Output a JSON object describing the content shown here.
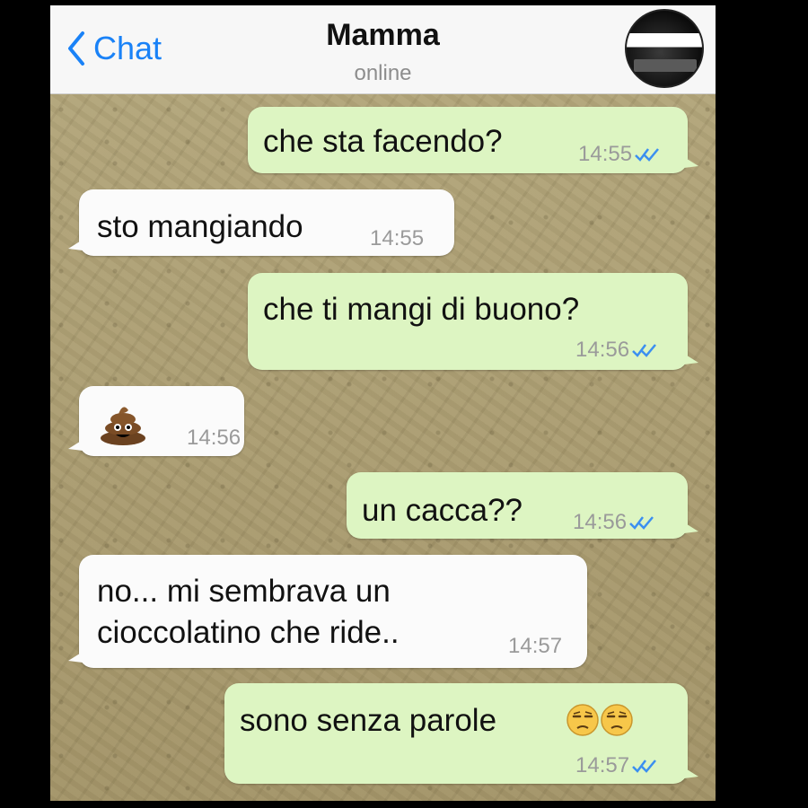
{
  "header": {
    "back_label": "Chat",
    "contact_name": "Mamma",
    "status": "online"
  },
  "messages": [
    {
      "direction": "outgoing",
      "text": "che sta facendo?",
      "time": "14:55",
      "read_ticks": true
    },
    {
      "direction": "incoming",
      "text": "sto mangiando",
      "time": "14:55"
    },
    {
      "direction": "outgoing",
      "text": "che ti mangi di buono?",
      "time": "14:56",
      "read_ticks": true
    },
    {
      "direction": "incoming",
      "text": "",
      "emoji": "pile-of-poo",
      "time": "14:56"
    },
    {
      "direction": "outgoing",
      "text": "un cacca??",
      "time": "14:56",
      "read_ticks": true
    },
    {
      "direction": "incoming",
      "text": "no... mi sembrava un\ncioccolatino che ride..",
      "time": "14:57"
    },
    {
      "direction": "outgoing",
      "text": "sono senza parole",
      "emoji": [
        "unamused-face",
        "unamused-face"
      ],
      "time": "14:57",
      "read_ticks": true
    }
  ],
  "colors": {
    "accent": "#1a82f7",
    "outgoing_bubble": "#ddf5c2",
    "incoming_bubble": "#fbfbfb",
    "tick": "#3b8ff0"
  }
}
